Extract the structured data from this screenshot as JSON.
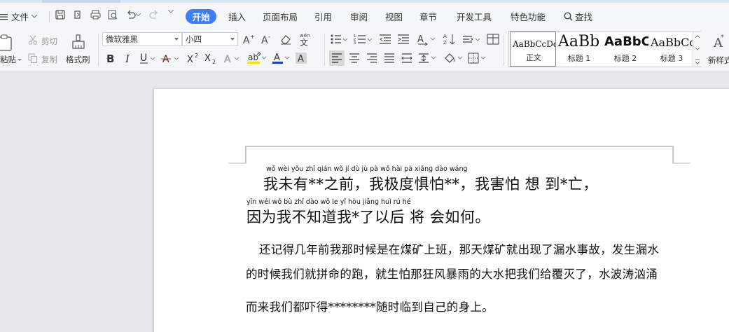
{
  "menu": {
    "file_label": "文件",
    "tabs": [
      "开始",
      "插入",
      "页面布局",
      "引用",
      "审阅",
      "视图",
      "章节",
      "开发工具",
      "特色功能"
    ],
    "search_label": "查找"
  },
  "ribbon": {
    "paste_label": "粘贴",
    "cut_label": "剪切",
    "copy_label": "复制",
    "format_painter_label": "格式刷",
    "font_name": "微软雅黑",
    "font_size": "小四",
    "styles": [
      {
        "sample": "AaBbCcDd",
        "name": "正文"
      },
      {
        "sample": "AaBb",
        "name": "标题 1"
      },
      {
        "sample": "AaBbC",
        "name": "标题 2"
      },
      {
        "sample": "AaBbCc",
        "name": "标题 3"
      }
    ],
    "new_style_label": "新样式"
  },
  "document": {
    "pinyin_line1": "wǒ  wèi yǒu      zhī qián       wǒ  jí   dù  jù  pà            wǒ  hài  pà  xiǎnɡ dào   wánɡ",
    "hanzi_line1": "我未有**之前，我极度惧怕**，我害怕 想 到*亡，",
    "pinyin_line2": "yīn wéi  wǒ   bù  zhī dào  wǒ      le   yǐ  hòu jiānɡ huì  rú   hé",
    "hanzi_line2": "因为我不知道我*了以后 将 会如何。",
    "para1_line1": "还记得几年前我那时候是在煤矿上班，那天煤矿就出现了漏水事故，发生漏水",
    "para1_line2": "的时候我们就拼命的跑，就生怕那狂风暴雨的大水把我们给覆灭了，水波涛汹涌",
    "para1_line3": "而来我们都吓得********随时临到自己的身上。"
  }
}
